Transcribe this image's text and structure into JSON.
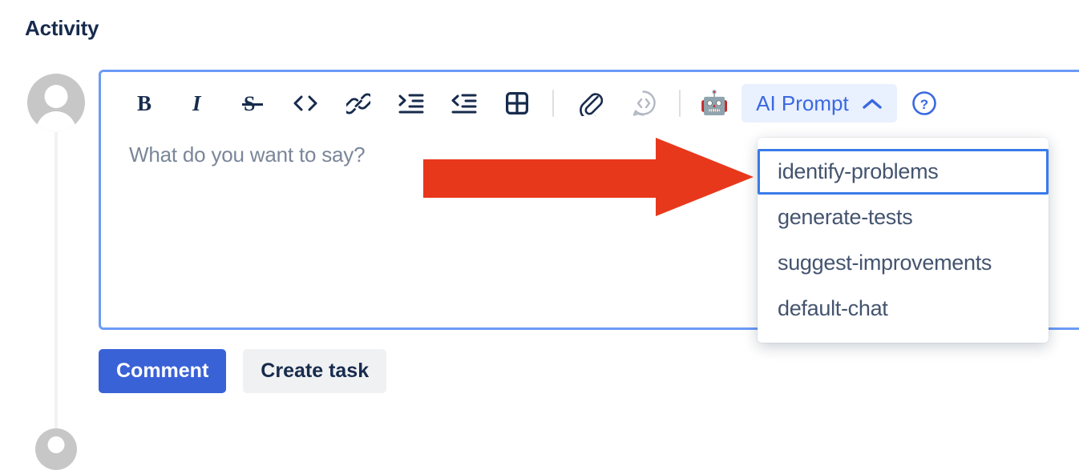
{
  "section": {
    "heading": "Activity"
  },
  "avatars": {
    "primary_name": "user-avatar",
    "secondary_name": "user-avatar-next"
  },
  "editor": {
    "placeholder": "What do you want to say?",
    "toolbar": [
      {
        "name": "bold-icon",
        "label": "B",
        "kind": "icon",
        "state": "normal"
      },
      {
        "name": "italic-icon",
        "label": "I",
        "kind": "icon",
        "state": "normal"
      },
      {
        "name": "strikethrough-icon",
        "label": "S",
        "kind": "icon",
        "state": "normal"
      },
      {
        "name": "code-icon",
        "label": "<>",
        "kind": "icon",
        "state": "normal"
      },
      {
        "name": "link-icon",
        "label": "link",
        "kind": "icon",
        "state": "normal"
      },
      {
        "name": "indent-increase-icon",
        "label": "indent",
        "kind": "icon",
        "state": "normal"
      },
      {
        "name": "indent-decrease-icon",
        "label": "outdent",
        "kind": "icon",
        "state": "normal"
      },
      {
        "name": "table-icon",
        "label": "table",
        "kind": "icon",
        "state": "normal"
      },
      {
        "name": "toolbar-separator-1",
        "label": "",
        "kind": "separator",
        "state": "normal"
      },
      {
        "name": "attachment-icon",
        "label": "attach",
        "kind": "icon",
        "state": "normal"
      },
      {
        "name": "code-snippet-icon",
        "label": "code snippet",
        "kind": "icon",
        "state": "muted"
      },
      {
        "name": "toolbar-separator-2",
        "label": "",
        "kind": "separator",
        "state": "normal"
      },
      {
        "name": "robot-icon",
        "label": "🤖",
        "kind": "emoji",
        "state": "normal"
      }
    ],
    "ai_prompt": {
      "label": "AI Prompt",
      "chevron": "chevron-up-icon",
      "expanded": true
    },
    "help": {
      "name": "help-icon",
      "label": "?"
    }
  },
  "ai_prompt_menu": {
    "items": [
      {
        "label": "identify-problems",
        "selected": true
      },
      {
        "label": "generate-tests",
        "selected": false
      },
      {
        "label": "suggest-improvements",
        "selected": false
      },
      {
        "label": "default-chat",
        "selected": false
      }
    ]
  },
  "actions": {
    "comment_label": "Comment",
    "create_task_label": "Create task"
  },
  "annotation": {
    "type": "arrow",
    "direction": "right",
    "color": "#E8381C",
    "points_to": "identify-problems"
  },
  "colors": {
    "accent_blue": "#3A62D7",
    "link_blue": "#3A68E0",
    "editor_border": "#6B9BF7",
    "selected_border": "#3A7BEA",
    "text_dark": "#172B4D",
    "text_muted": "#7A8699",
    "arrow_red": "#E8381C"
  }
}
